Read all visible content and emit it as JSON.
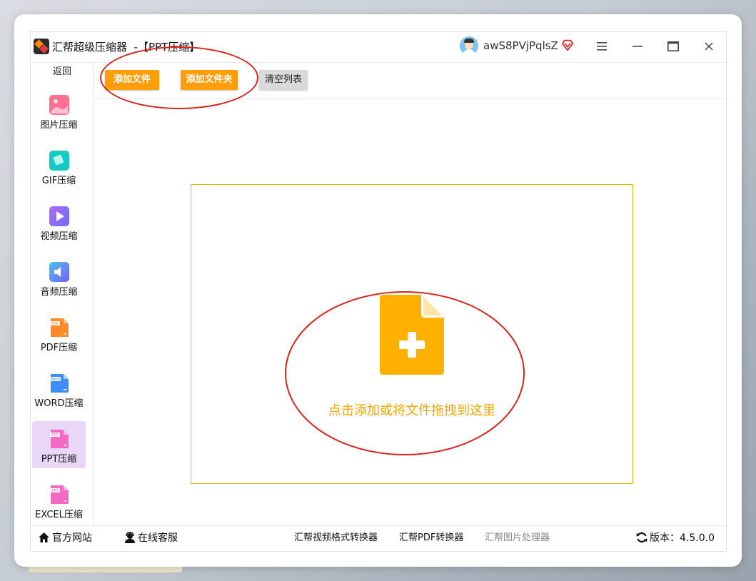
{
  "window": {
    "title": "汇帮超级压缩器  -【PPT压缩】",
    "username": "awS8PVjPqlsZ"
  },
  "sidebar": {
    "back_label": "返回",
    "items": [
      {
        "label": "图片压缩",
        "icon": "image-icon",
        "color": "#ff6f8f"
      },
      {
        "label": "GIF压缩",
        "icon": "gif-icon",
        "color": "#13c9c0"
      },
      {
        "label": "视频压缩",
        "icon": "video-icon",
        "color": "#8f6cf5"
      },
      {
        "label": "音频压缩",
        "icon": "audio-icon",
        "color": "#5a86f6"
      },
      {
        "label": "PDF压缩",
        "icon": "pdf-file-icon",
        "color": "#ff8a2a",
        "tag": "PDF"
      },
      {
        "label": "WORD压缩",
        "icon": "word-file-icon",
        "color": "#3d8ef5",
        "tag": "Word"
      },
      {
        "label": "PPT压缩",
        "icon": "ppt-file-icon",
        "color": "#f26ac3",
        "tag": "PPT",
        "active": true
      },
      {
        "label": "EXCEL压缩",
        "icon": "excel-file-icon",
        "color": "#f26ac3",
        "tag": "PPT"
      }
    ]
  },
  "toolbar": {
    "add_file": "添加文件",
    "add_folder": "添加文件夹",
    "clear_list": "清空列表"
  },
  "drop_zone": {
    "text": "点击添加或将文件拖拽到这里"
  },
  "bottom": {
    "official_site": "官方网站",
    "online_service": "在线客服",
    "video_converter": "汇帮视频格式转换器",
    "pdf_converter": "汇帮PDF转换器",
    "image_processor": "汇帮图片处理器",
    "version": "版本：4.5.0.0"
  },
  "colors": {
    "accent_orange": "#ff9d0a",
    "file_icon": "#ffb000",
    "annotation_red": "#d8231c",
    "active_nav": "#ead7f7"
  }
}
